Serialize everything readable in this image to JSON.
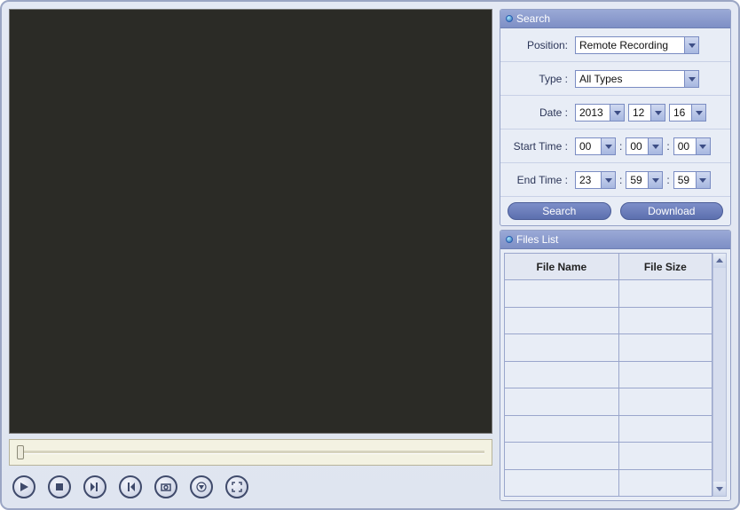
{
  "search": {
    "title": "Search",
    "position_label": "Position:",
    "position_value": "Remote Recording",
    "type_label": "Type :",
    "type_value": "All Types",
    "date_label": "Date :",
    "date_year": "2013",
    "date_month": "12",
    "date_day": "16",
    "start_label": "Start Time :",
    "start_h": "00",
    "start_m": "00",
    "start_s": "00",
    "end_label": "End Time :",
    "end_h": "23",
    "end_m": "59",
    "end_s": "59",
    "search_btn": "Search",
    "download_btn": "Download"
  },
  "files": {
    "title": "Files List",
    "col_name": "File Name",
    "col_size": "File Size"
  }
}
